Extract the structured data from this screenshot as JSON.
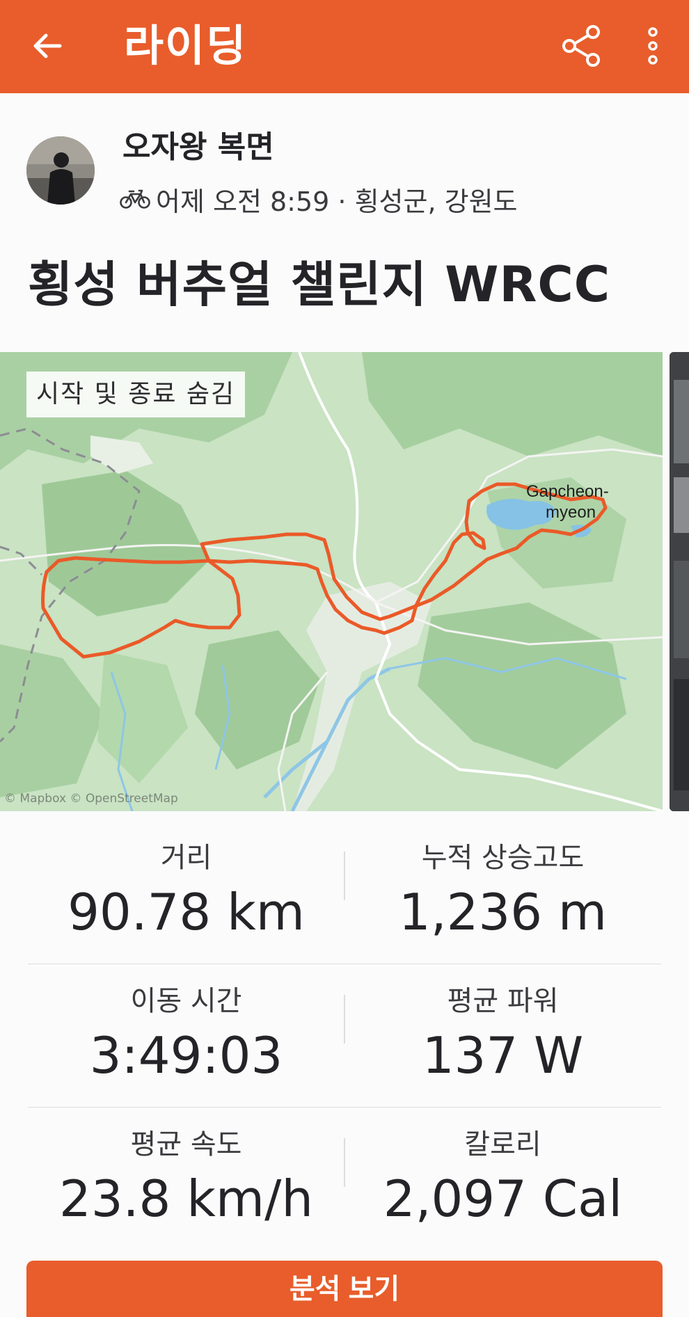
{
  "header": {
    "title": "라이딩",
    "back_icon": "arrow-left-icon",
    "share_icon": "share-icon",
    "more_icon": "more-vertical-icon",
    "color": "#e85d2b"
  },
  "athlete": {
    "name": "오자왕 복면",
    "activity_icon": "bicycle-icon",
    "meta": "어제 오전 8:59 · 횡성군, 강원도"
  },
  "activity": {
    "title": "횡성 버추얼 챌린지 WRCC"
  },
  "map": {
    "toggle_label": "시작 및 종료 숨김",
    "place_label_line1": "Gapcheon-",
    "place_label_line2": "myeon",
    "attribution": "© Mapbox © OpenStreetMap",
    "route_color": "#ea5a28"
  },
  "stats": [
    {
      "label": "거리",
      "value": "90.78 km"
    },
    {
      "label": "누적 상승고도",
      "value": "1,236 m"
    },
    {
      "label": "이동 시간",
      "value": "3:49:03"
    },
    {
      "label": "평균 파워",
      "value": "137 W"
    },
    {
      "label": "평균 속도",
      "value": "23.8 km/h"
    },
    {
      "label": "칼로리",
      "value": "2,097 Cal"
    }
  ],
  "actions": {
    "analysis_label": "분석 보기"
  }
}
